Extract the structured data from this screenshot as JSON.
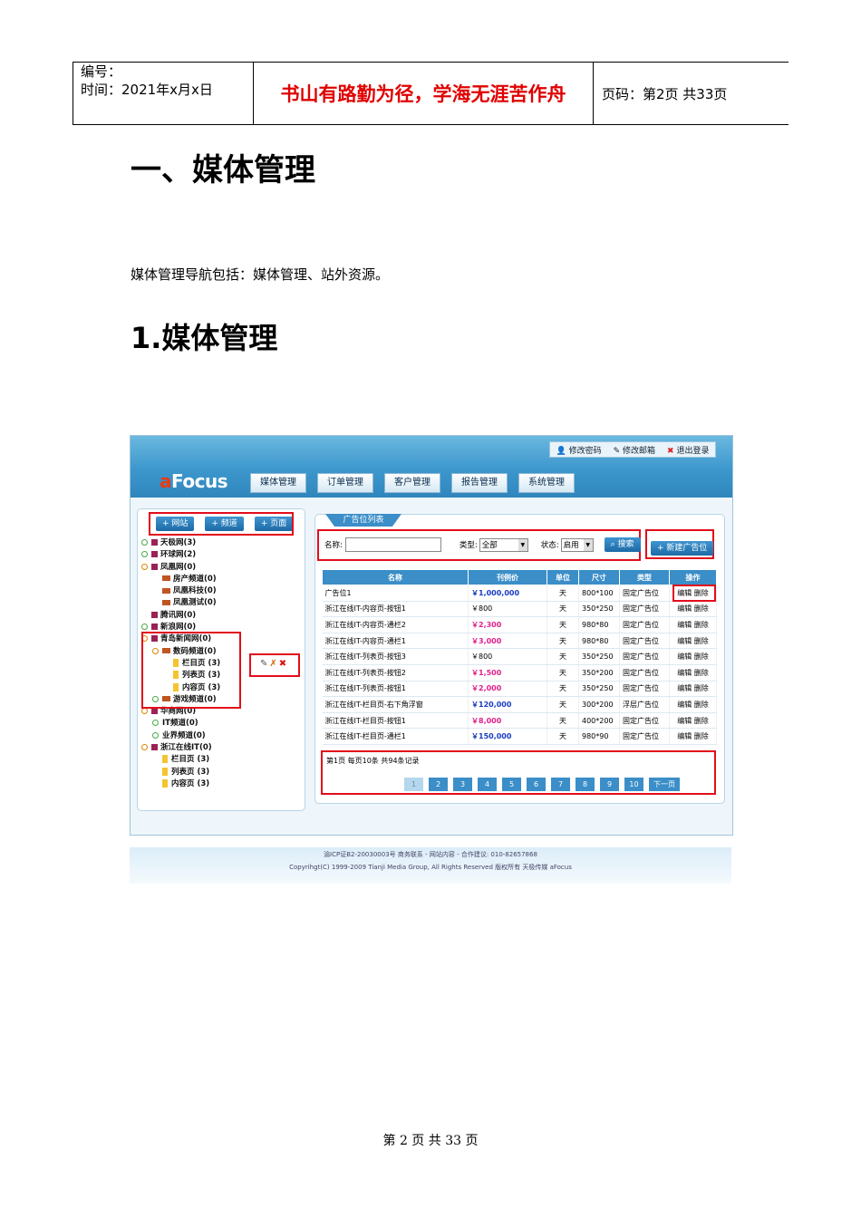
{
  "header": {
    "number_label": "编号：",
    "date_line": "时间：2021年x月x日",
    "motto": "书山有路勤为径，学海无涯苦作舟",
    "page_info": "页码：第2页  共33页"
  },
  "heading1": "一、媒体管理",
  "intro": "媒体管理导航包括：媒体管理、站外资源。",
  "heading2": "1.媒体管理",
  "app": {
    "logo_a": "a",
    "logo_rest": "Focus",
    "top_links": [
      "修改密码",
      "修改邮箱",
      "退出登录"
    ],
    "nav_tabs": [
      "媒体管理",
      "订单管理",
      "客户管理",
      "报告管理",
      "系统管理"
    ],
    "left_buttons": [
      "+ 网站",
      "+ 频道",
      "+ 页面"
    ],
    "tree": [
      {
        "t": "天极网(3)",
        "lv": 0,
        "icon": "site",
        "dot": "g"
      },
      {
        "t": "环球网(2)",
        "lv": 0,
        "icon": "site",
        "dot": "g"
      },
      {
        "t": "凤凰网(0)",
        "lv": 0,
        "icon": "site",
        "dot": "o"
      },
      {
        "t": "房产频道(0)",
        "lv": 1,
        "icon": "folder"
      },
      {
        "t": "凤凰科技(0)",
        "lv": 1,
        "icon": "folder"
      },
      {
        "t": "凤凰测试(0)",
        "lv": 1,
        "icon": "folder"
      },
      {
        "t": "腾讯网(0)",
        "lv": 0,
        "icon": "site"
      },
      {
        "t": "新浪网(0)",
        "lv": 0,
        "icon": "site",
        "dot": "g"
      },
      {
        "t": "青岛新闻网(0)",
        "lv": 0,
        "icon": "site",
        "dot": "o"
      },
      {
        "t": "数码频道(0)",
        "lv": 1,
        "icon": "folder",
        "dot": "o"
      },
      {
        "t": "栏目页 (3)",
        "lv": 2,
        "icon": "page"
      },
      {
        "t": "列表页 (3)",
        "lv": 2,
        "icon": "page"
      },
      {
        "t": "内容页 (3)",
        "lv": 2,
        "icon": "page"
      },
      {
        "t": "游戏频道(0)",
        "lv": 1,
        "icon": "folder",
        "dot": "g"
      },
      {
        "t": "华商网(0)",
        "lv": 0,
        "icon": "site",
        "dot": "o"
      },
      {
        "t": "IT频道(0)",
        "lv": 1,
        "icon": "none",
        "dot": "g"
      },
      {
        "t": "业界频道(0)",
        "lv": 1,
        "icon": "none",
        "dot": "g"
      },
      {
        "t": "浙江在线IT(0)",
        "lv": 0,
        "icon": "site",
        "dot": "o"
      },
      {
        "t": "栏目页 (3)",
        "lv": 1,
        "icon": "page"
      },
      {
        "t": "列表页 (3)",
        "lv": 1,
        "icon": "page"
      },
      {
        "t": "内容页 (3)",
        "lv": 1,
        "icon": "page"
      }
    ],
    "panel_title": "广告位列表",
    "search": {
      "name_label": "名称:",
      "type_label": "类型:",
      "type_value": "全部",
      "status_label": "状态:",
      "status_value": "启用",
      "search_button": "搜索",
      "new_button": "+ 新建广告位"
    },
    "table_headers": [
      "名称",
      "刊例价",
      "单位",
      "尺寸",
      "类型",
      "操作"
    ],
    "rows": [
      {
        "name": "广告位1",
        "price": "￥1,000,000",
        "pc": "b",
        "unit": "天",
        "size": "800*100",
        "type": "固定广告位"
      },
      {
        "name": "浙江在线IT-内容页-按钮1",
        "price": "￥800",
        "pc": "k",
        "unit": "天",
        "size": "350*250",
        "type": "固定广告位"
      },
      {
        "name": "浙江在线IT-内容页-通栏2",
        "price": "￥2,300",
        "pc": "p",
        "unit": "天",
        "size": "980*80",
        "type": "固定广告位"
      },
      {
        "name": "浙江在线IT-内容页-通栏1",
        "price": "￥3,000",
        "pc": "p",
        "unit": "天",
        "size": "980*80",
        "type": "固定广告位"
      },
      {
        "name": "浙江在线IT-列表页-按钮3",
        "price": "￥800",
        "pc": "k",
        "unit": "天",
        "size": "350*250",
        "type": "固定广告位"
      },
      {
        "name": "浙江在线IT-列表页-按钮2",
        "price": "￥1,500",
        "pc": "p",
        "unit": "天",
        "size": "350*200",
        "type": "固定广告位"
      },
      {
        "name": "浙江在线IT-列表页-按钮1",
        "price": "￥2,000",
        "pc": "p",
        "unit": "天",
        "size": "350*250",
        "type": "固定广告位"
      },
      {
        "name": "浙江在线IT-栏目页-右下角浮窗",
        "price": "￥120,000",
        "pc": "b",
        "unit": "天",
        "size": "300*200",
        "type": "浮层广告位"
      },
      {
        "name": "浙江在线IT-栏目页-按钮1",
        "price": "￥8,000",
        "pc": "p",
        "unit": "天",
        "size": "400*200",
        "type": "固定广告位"
      },
      {
        "name": "浙江在线IT-栏目页-通栏1",
        "price": "￥150,000",
        "pc": "b",
        "unit": "天",
        "size": "980*90",
        "type": "固定广告位"
      }
    ],
    "op_edit": "编辑",
    "op_delete": "删除",
    "page_summary": "第1页 每页10条 共94条记录",
    "pages": [
      "1",
      "2",
      "3",
      "4",
      "5",
      "6",
      "7",
      "8",
      "9",
      "10"
    ],
    "next_label": "下一页",
    "footer_line1": "渝ICP证B2-20030003号 商务联系 - 网站内容 - 合作建议: 010-82657868",
    "footer_line2": "Copyrihgt(C) 1999-2009 Tianji Media Group, All Rights Reserved 版权所有 天极传媒 aFocus"
  },
  "page_footer": "第 2 页 共 33 页"
}
